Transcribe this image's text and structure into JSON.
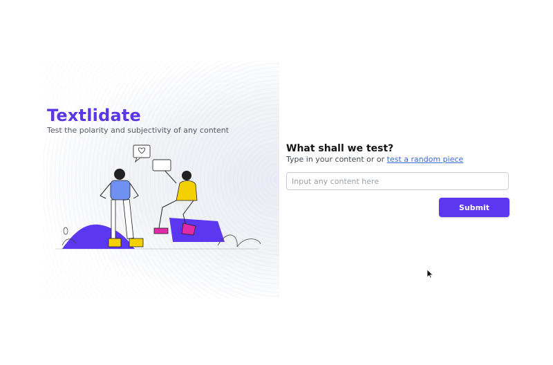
{
  "hero": {
    "title": "Textlidate",
    "subtitle": "Test the polarity and subjectivity of any content"
  },
  "form": {
    "title": "What shall we test?",
    "help_prefix": "Type in your content or or ",
    "random_link_label": "test a random piece",
    "input_placeholder": "Input any content here",
    "input_value": "",
    "submit_label": "Submit"
  },
  "colors": {
    "brand": "#5a36e6",
    "button": "#5b37f2",
    "link": "#3a6ad6",
    "accent_yellow": "#f4d000",
    "accent_magenta": "#e02aa8"
  },
  "icons": [
    "heart-icon",
    "cursor-arrow-icon"
  ]
}
